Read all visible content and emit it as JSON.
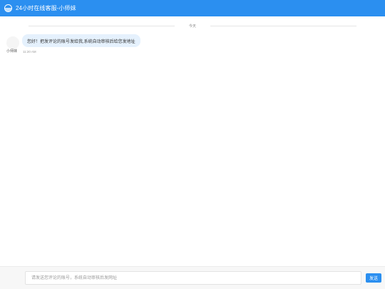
{
  "header": {
    "title": "24小时在线客服-小师妹",
    "logo_icon": "chat-logo-icon"
  },
  "chat": {
    "date_divider": "今天",
    "messages": [
      {
        "sender": "小师妹",
        "text": "您好！把发评论的账号发给我,系统自动审核后给您发地址",
        "time": "11:20 AM"
      }
    ]
  },
  "composer": {
    "placeholder": "请发送您评论的账号，系统自动审核后发网址",
    "value": "",
    "send_label": "发送"
  },
  "colors": {
    "accent": "#2b8ff0",
    "bubble": "#e5f1fd"
  }
}
